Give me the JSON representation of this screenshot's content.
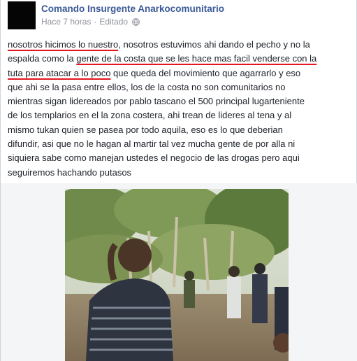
{
  "post": {
    "author": "Comando Insurgente Anarkocomunitario",
    "time": "Hace 7 horas",
    "separator": "·",
    "edited": "Editado",
    "privacy_icon": "globe-icon",
    "text_lines": [
      [
        "nosotros hicimos lo nuestro",
        ", nosotros estuvimos ahi dando el pecho y no la"
      ],
      [
        "espalda como la ",
        "gente de la costa que se les hace mas facil venderse con la"
      ],
      [
        "tuta para atacar a lo poco",
        " que queda del movimiento que agarrarlo y eso"
      ],
      [
        "que ahi se la pasa entre ellos, los de la costa no son comunitarios no"
      ],
      [
        "mientras sigan lidereados por pablo tascano el 500 principal lugarteniente"
      ],
      [
        "de los templarios en el la zona costera, ahi trean de lideres al tena y al"
      ],
      [
        "mismo tukan quien se pasea por todo aquila, eso es lo que deberian"
      ],
      [
        "difundir, asi que no le hagan al martir tal vez mucha gente de por alla ni"
      ],
      [
        "siquiera sabe como manejan ustedes el negocio de las drogas pero aqui"
      ],
      [
        "seguiremos hachando putasos"
      ]
    ],
    "underline_color": "#e4161f",
    "link_color": "#3b5998"
  },
  "photo": {
    "description_icon": "photo-image"
  }
}
